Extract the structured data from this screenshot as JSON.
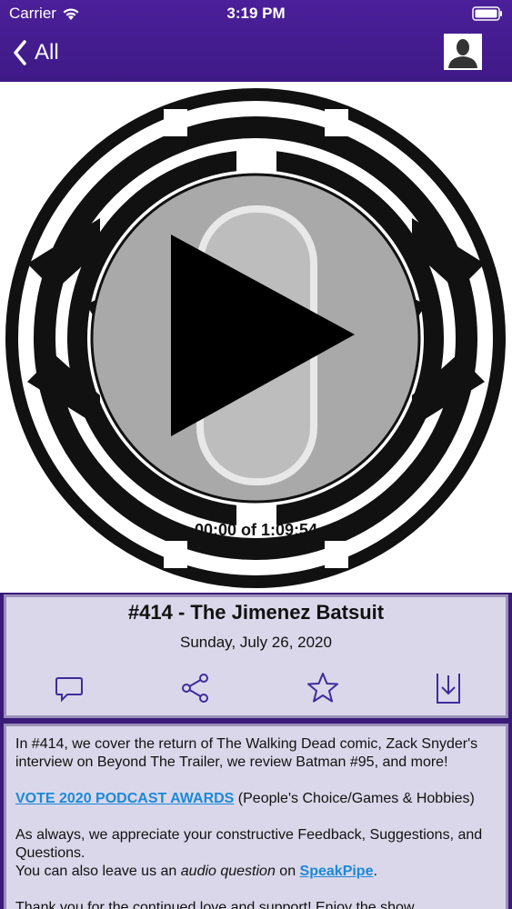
{
  "status": {
    "carrier": "Carrier",
    "time": "3:19 PM"
  },
  "nav": {
    "back_label": "All"
  },
  "player": {
    "time_readout": "00:00 of 1:09:54"
  },
  "episode": {
    "title": "#414 - The Jimenez Batsuit",
    "date": "Sunday, July 26, 2020"
  },
  "description": {
    "intro": "In #414, we cover the return of The Walking Dead comic, Zack Snyder's interview on Beyond The Trailer, we review Batman #95, and more!",
    "vote_link": "VOTE 2020 PODCAST AWARDS",
    "vote_suffix": " (People's Choice/Games & Hobbies)",
    "feedback": "As always, we appreciate your constructive Feedback, Suggestions, and Questions.",
    "audio_prefix": "You can also leave us an ",
    "audio_em": "audio question",
    "audio_mid": " on ",
    "speakpipe_link": "SpeakPipe",
    "audio_end": ".",
    "cutoff": "Thank you for the continued love and support! Enjoy the show."
  },
  "colors": {
    "header": "#4b1f9a",
    "panel": "#dbd7ea",
    "icon": "#3d2c9c",
    "link": "#1a8ad8"
  }
}
